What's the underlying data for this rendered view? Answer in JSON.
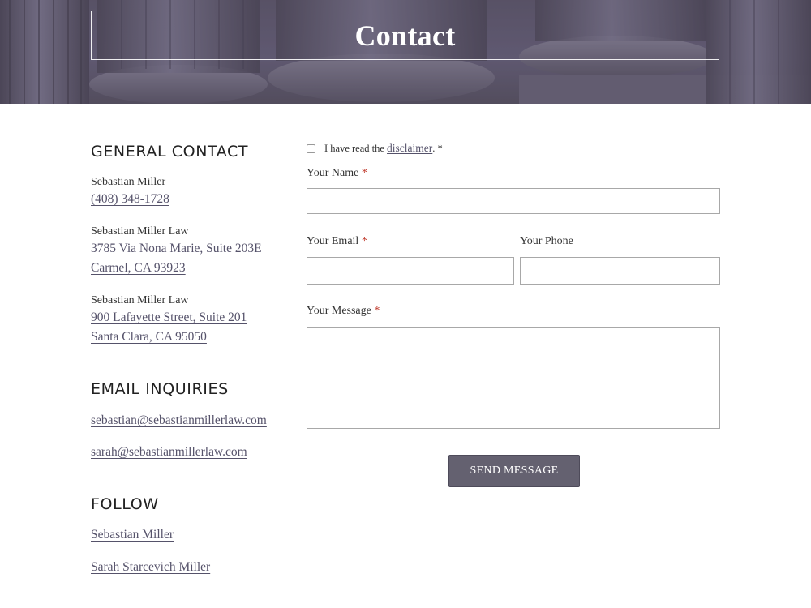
{
  "header": {
    "title": "Contact"
  },
  "general_contact": {
    "heading": "GENERAL CONTACT",
    "person": "Sebastian Miller",
    "phone": "(408) 348-1728",
    "office1": {
      "name": "Sebastian Miller Law",
      "line1": "3785 Via Nona Marie, Suite 203E",
      "line2": "Carmel, CA 93923"
    },
    "office2": {
      "name": "Sebastian Miller Law",
      "line1": "900 Lafayette Street, Suite 201",
      "line2": "Santa Clara, CA 95050"
    }
  },
  "email_inquiries": {
    "heading": "EMAIL INQUIRIES",
    "emails": [
      "sebastian@sebastianmillerlaw.com",
      "sarah@sebastianmillerlaw.com"
    ]
  },
  "follow": {
    "heading": "FOLLOW",
    "links": [
      "Sebastian Miller",
      "Sarah Starcevich Miller"
    ]
  },
  "form": {
    "disclaimer_prefix": "I have read the",
    "disclaimer_link": "disclaimer",
    "disclaimer_suffix": ". *",
    "name_label": "Your Name",
    "email_label": "Your Email",
    "phone_label": "Your Phone",
    "message_label": "Your Message",
    "required_mark": "*",
    "name_value": "",
    "email_value": "",
    "phone_value": "",
    "message_value": "",
    "submit_label": "SEND MESSAGE"
  },
  "colors": {
    "accent": "#646170",
    "link": "#55526a",
    "required": "#c0392b"
  }
}
